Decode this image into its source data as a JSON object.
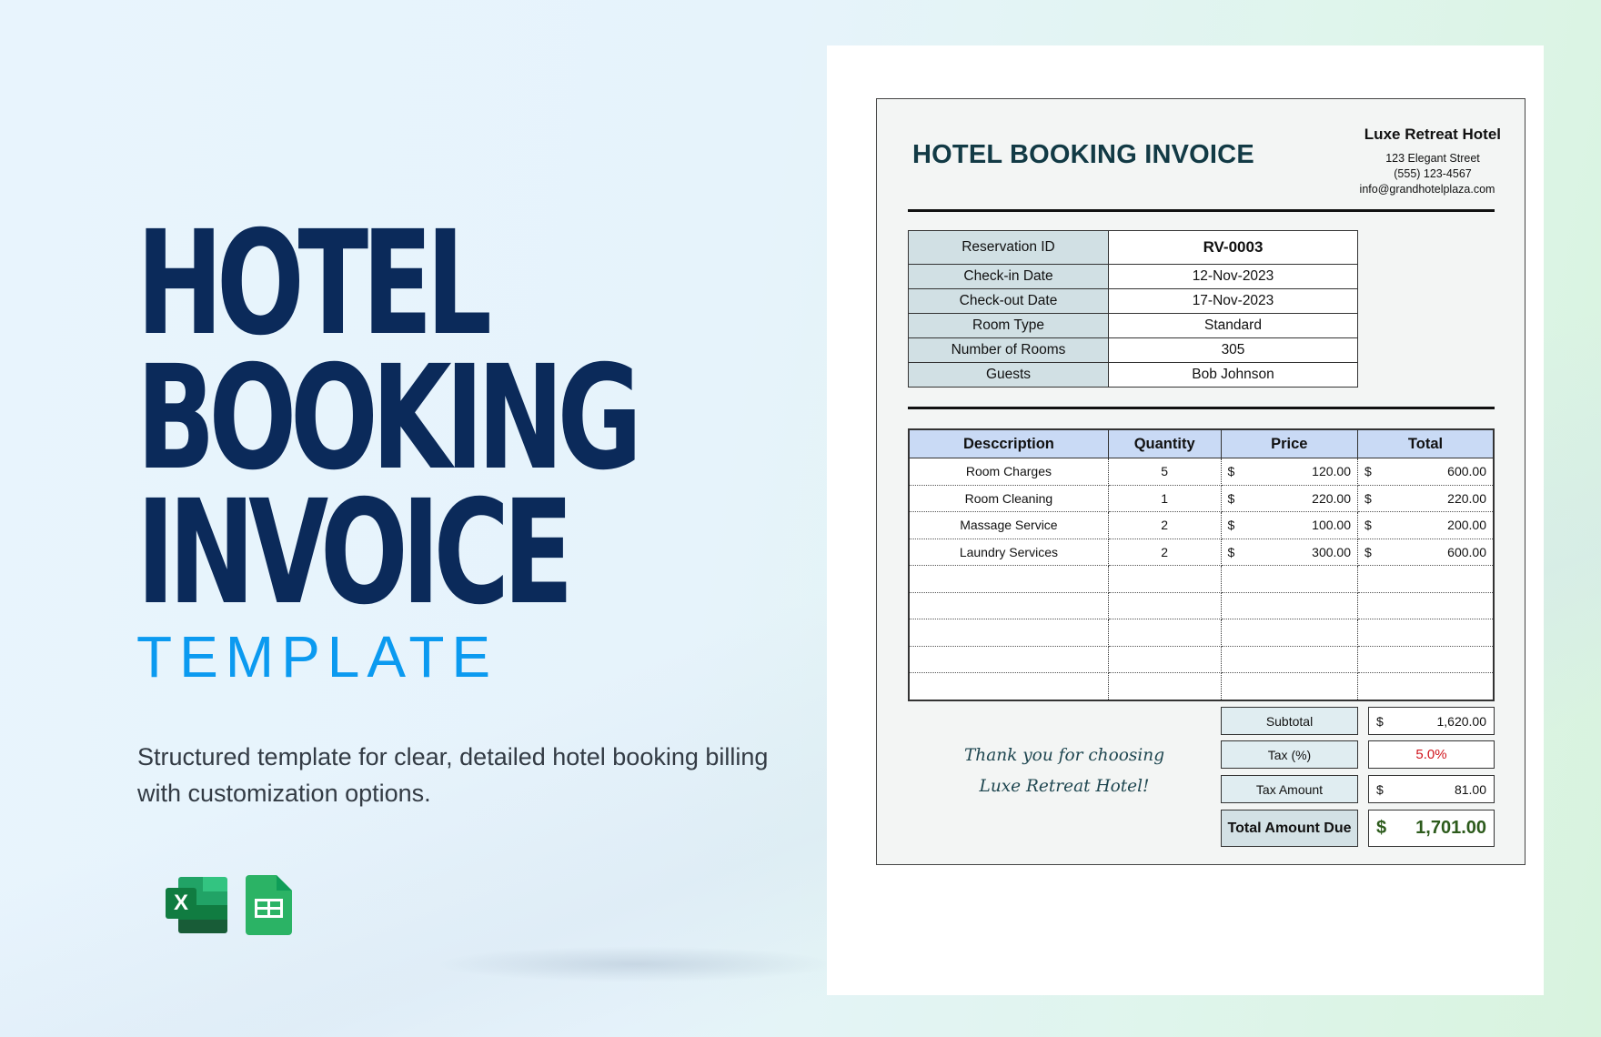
{
  "hero": {
    "title_lines": [
      "HOTEL",
      "BOOKING",
      "INVOICE"
    ],
    "subtitle": "TEMPLATE",
    "description": "Structured template for clear, detailed hotel booking billing with customization options.",
    "app_icons": [
      {
        "name": "excel-icon",
        "letter": "X"
      },
      {
        "name": "google-sheets-icon"
      }
    ]
  },
  "invoice": {
    "title": "HOTEL BOOKING INVOICE",
    "hotel": {
      "name": "Luxe Retreat Hotel",
      "address": "123 Elegant Street",
      "phone": "(555) 123-4567",
      "email": "info@grandhotelplaza.com"
    },
    "details": [
      {
        "label": "Reservation ID",
        "value": "RV-0003"
      },
      {
        "label": "Check-in Date",
        "value": "12-Nov-2023"
      },
      {
        "label": "Check-out Date",
        "value": "17-Nov-2023"
      },
      {
        "label": "Room Type",
        "value": "Standard"
      },
      {
        "label": "Number of Rooms",
        "value": "305"
      },
      {
        "label": "Guests",
        "value": "Bob Johnson"
      }
    ],
    "items_headers": [
      "Desccription",
      "Quantity",
      "Price",
      "Total"
    ],
    "currency_symbol": "$",
    "items": [
      {
        "description": "Room Charges",
        "quantity": "5",
        "price": "120.00",
        "total": "600.00"
      },
      {
        "description": "Room Cleaning",
        "quantity": "1",
        "price": "220.00",
        "total": "220.00"
      },
      {
        "description": "Massage Service",
        "quantity": "2",
        "price": "100.00",
        "total": "200.00"
      },
      {
        "description": "Laundry Services",
        "quantity": "2",
        "price": "300.00",
        "total": "600.00"
      },
      {
        "description": "",
        "quantity": "",
        "price": "",
        "total": ""
      },
      {
        "description": "",
        "quantity": "",
        "price": "",
        "total": ""
      },
      {
        "description": "",
        "quantity": "",
        "price": "",
        "total": ""
      },
      {
        "description": "",
        "quantity": "",
        "price": "",
        "total": ""
      },
      {
        "description": "",
        "quantity": "",
        "price": "",
        "total": ""
      }
    ],
    "thank_you": [
      "Thank you for choosing",
      "Luxe Retreat Hotel!"
    ],
    "summary": {
      "subtotal_label": "Subtotal",
      "subtotal_value": "1,620.00",
      "tax_pct_label": "Tax (%)",
      "tax_pct_value": "5.0%",
      "tax_amount_label": "Tax Amount",
      "tax_amount_value": "81.00",
      "total_label": "Total Amount Due",
      "total_value": "1,701.00"
    },
    "colors": {
      "title": "#123a45",
      "header_fill": "#c9daf5",
      "label_fill": "#d1e0e4",
      "tax_red": "#d0141c",
      "total_green": "#2d5b1c"
    }
  }
}
